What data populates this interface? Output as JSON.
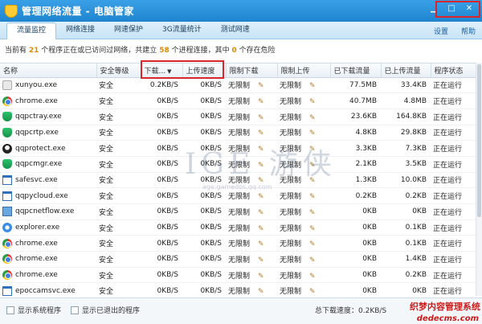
{
  "window": {
    "title": "管理网络流量 - 电脑管家"
  },
  "tabs": [
    "流量监控",
    "网络连接",
    "网速保护",
    "3G流量统计",
    "测试网速"
  ],
  "tab_links": {
    "settings": "设置",
    "help": "帮助"
  },
  "summary": {
    "part1": "当前有",
    "programs": "21",
    "part2": "个程序正在或已访问过网络，共建立",
    "connections": "58",
    "part3": "个进程连接，其中",
    "danger": "0",
    "part4": "个存在危险"
  },
  "columns": [
    "名称",
    "安全等级",
    "下载...",
    "上传速度",
    "限制下载",
    "限制上传",
    "已下载流量",
    "已上传流量",
    "程序状态"
  ],
  "rows": [
    {
      "icon": "xunyou-icon",
      "name": "xunyou.exe",
      "security": "安全",
      "down": "0.2KB/S",
      "up": "0KB/S",
      "limit_down": "无限制",
      "limit_up": "无限制",
      "downloaded": "77.5MB",
      "uploaded": "33.4KB",
      "status": "正在运行"
    },
    {
      "icon": "chrome-icon",
      "name": "chrome.exe",
      "security": "安全",
      "down": "0KB/S",
      "up": "0KB/S",
      "limit_down": "无限制",
      "limit_up": "无限制",
      "downloaded": "40.7MB",
      "uploaded": "4.8MB",
      "status": "正在运行"
    },
    {
      "icon": "shield-icon",
      "name": "qqpctray.exe",
      "security": "安全",
      "down": "0KB/S",
      "up": "0KB/S",
      "limit_down": "无限制",
      "limit_up": "无限制",
      "downloaded": "23.6KB",
      "uploaded": "164.8KB",
      "status": "正在运行"
    },
    {
      "icon": "shield-icon",
      "name": "qqpcrtp.exe",
      "security": "安全",
      "down": "0KB/S",
      "up": "0KB/S",
      "limit_down": "无限制",
      "limit_up": "无限制",
      "downloaded": "4.8KB",
      "uploaded": "29.8KB",
      "status": "正在运行"
    },
    {
      "icon": "qq-icon",
      "name": "qqprotect.exe",
      "security": "安全",
      "down": "0KB/S",
      "up": "0KB/S",
      "limit_down": "无限制",
      "limit_up": "无限制",
      "downloaded": "3.3KB",
      "uploaded": "7.3KB",
      "status": "正在运行"
    },
    {
      "icon": "shield-icon",
      "name": "qqpcmgr.exe",
      "security": "安全",
      "down": "0KB/S",
      "up": "0KB/S",
      "limit_down": "无限制",
      "limit_up": "无限制",
      "downloaded": "2.1KB",
      "uploaded": "3.5KB",
      "status": "正在运行"
    },
    {
      "icon": "window-icon",
      "name": "safesvc.exe",
      "security": "安全",
      "down": "0KB/S",
      "up": "0KB/S",
      "limit_down": "无限制",
      "limit_up": "无限制",
      "downloaded": "1.3KB",
      "uploaded": "10.0KB",
      "status": "正在运行"
    },
    {
      "icon": "window-icon",
      "name": "qqpycloud.exe",
      "security": "安全",
      "down": "0KB/S",
      "up": "0KB/S",
      "limit_down": "无限制",
      "limit_up": "无限制",
      "downloaded": "0.2KB",
      "uploaded": "0.2KB",
      "status": "正在运行"
    },
    {
      "icon": "flow-icon",
      "name": "qqpcnetflow.exe",
      "security": "安全",
      "down": "0KB/S",
      "up": "0KB/S",
      "limit_down": "无限制",
      "limit_up": "无限制",
      "downloaded": "0KB",
      "uploaded": "0KB",
      "status": "正在运行"
    },
    {
      "icon": "ie-icon",
      "name": "explorer.exe",
      "security": "安全",
      "down": "0KB/S",
      "up": "0KB/S",
      "limit_down": "无限制",
      "limit_up": "无限制",
      "downloaded": "0KB",
      "uploaded": "0.1KB",
      "status": "正在运行"
    },
    {
      "icon": "chrome-icon",
      "name": "chrome.exe",
      "security": "安全",
      "down": "0KB/S",
      "up": "0KB/S",
      "limit_down": "无限制",
      "limit_up": "无限制",
      "downloaded": "0KB",
      "uploaded": "0.1KB",
      "status": "正在运行"
    },
    {
      "icon": "chrome-icon",
      "name": "chrome.exe",
      "security": "安全",
      "down": "0KB/S",
      "up": "0KB/S",
      "limit_down": "无限制",
      "limit_up": "无限制",
      "downloaded": "0KB",
      "uploaded": "1.4KB",
      "status": "正在运行"
    },
    {
      "icon": "chrome-icon",
      "name": "chrome.exe",
      "security": "安全",
      "down": "0KB/S",
      "up": "0KB/S",
      "limit_down": "无限制",
      "limit_up": "无限制",
      "downloaded": "0KB",
      "uploaded": "0.2KB",
      "status": "正在运行"
    },
    {
      "icon": "window-icon",
      "name": "epoccamsvc.exe",
      "security": "安全",
      "down": "0KB/S",
      "up": "0KB/S",
      "limit_down": "无限制",
      "limit_up": "无限制",
      "downloaded": "0KB",
      "uploaded": "0KB",
      "status": "正在运行"
    }
  ],
  "footer": {
    "show_system": "显示系统程序",
    "show_exited": "显示已退出的程序",
    "total_speed_label": "总下载速度：",
    "total_speed_value": "0.2KB/S"
  },
  "watermark": {
    "main": "IGE 游侠",
    "sub": "age.gamedos.qq.com"
  },
  "corner_mark": {
    "line1": "织梦内容管理系统",
    "line2": "dedecms.com"
  }
}
